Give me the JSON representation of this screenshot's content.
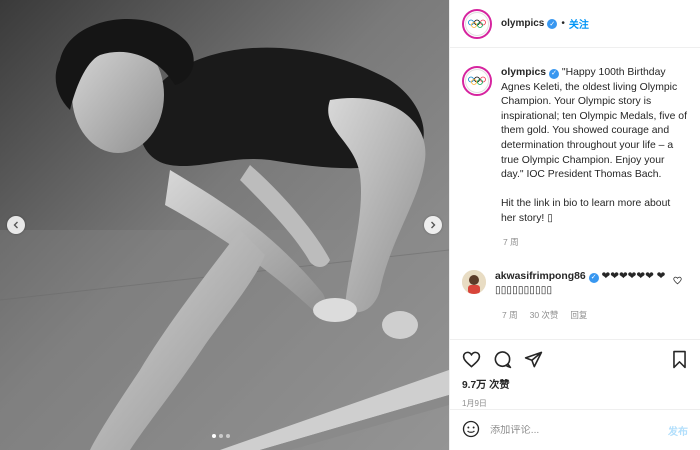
{
  "media": {
    "dots": [
      true,
      false,
      false
    ]
  },
  "header": {
    "username": "olympics",
    "separator": "•",
    "follow_label": "关注"
  },
  "caption": {
    "username": "olympics",
    "text": " \"Happy 100th Birthday Agnes Keleti, the oldest living Olympic Champion. Your Olympic story is inspirational; ten Olympic Medals, five of them gold. You showed courage and determination throughout your life – a true Olympic Champion. Enjoy your day.\"  IOC President Thomas Bach.",
    "text2": "Hit the link in bio to learn more about her story! ▯",
    "time": "7 周"
  },
  "comment": {
    "username": "akwasifrimpong86",
    "text": " ❤❤❤❤❤❤ ❤▯▯▯▯▯▯▯▯▯▯",
    "time": "7 周",
    "likes": "30 次赞",
    "reply": "回复"
  },
  "stats": {
    "likes": "9.7万 次赞",
    "date": "1月9日"
  },
  "compose": {
    "placeholder": "添加评论...",
    "post_label": "发布"
  }
}
